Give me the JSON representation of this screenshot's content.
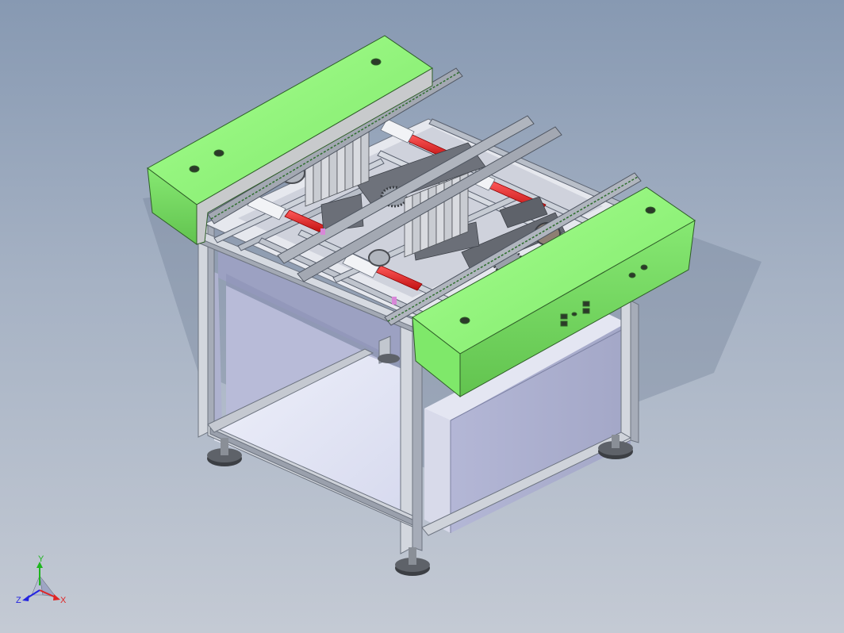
{
  "view": {
    "colors": {
      "background_top": "#8799b2",
      "background_bottom": "#c4cad4",
      "cover_green": "#8ef37a",
      "cover_green_dark": "#6cc95b",
      "frame_aluminum": "#c9ced6",
      "panel_lavender": "#b4b8d6",
      "rod_red": "#e02020",
      "foot_dark": "#4c4f54"
    }
  },
  "triad": {
    "x_label": "X",
    "y_label": "Y",
    "z_label": "Z",
    "x_color": "#e02424",
    "y_color": "#1fb51f",
    "z_color": "#2424e0"
  }
}
